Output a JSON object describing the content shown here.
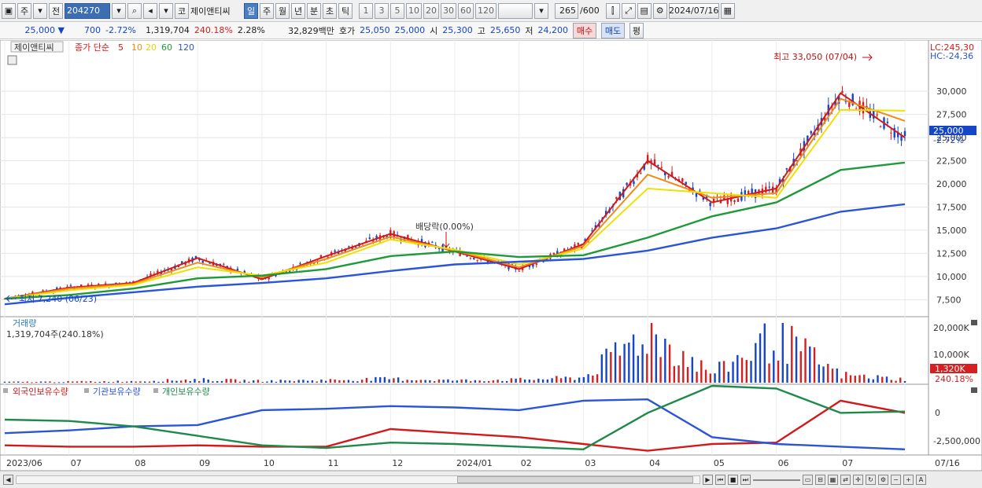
{
  "toolbar": {
    "market_label": "주",
    "prev_label": "전",
    "code_value": "204270",
    "co_label": "코",
    "stock_name": "제이앤티씨",
    "period_tabs": [
      "일",
      "주",
      "월",
      "년",
      "분",
      "초",
      "틱"
    ],
    "active_tab": "일",
    "interval_buttons": [
      "1",
      "3",
      "5",
      "10",
      "20",
      "30",
      "60",
      "120"
    ],
    "count_value": "265",
    "count_total": "/600",
    "date_value": "2024/07/16"
  },
  "quote": {
    "price": "25,000 ▼",
    "change": "700",
    "change_pct": "-2.72%",
    "volume": "1,319,704",
    "volume_ratio": "240.18%",
    "turnover_rate": "2.28%",
    "trade_value": "32,829백만",
    "bid_label": "호가",
    "bid1": "25,050",
    "bid2": "25,000",
    "open_label": "시",
    "open": "25,300",
    "high_label": "고",
    "high": "25,650",
    "low_label": "저",
    "low": "24,200",
    "buy_label": "매수",
    "sell_label": "매도",
    "eval_label": "평"
  },
  "legend": {
    "stock_name": "제이앤티씨",
    "ma_label": "종가 단순",
    "ma_periods": [
      "5",
      "10",
      "20",
      "60",
      "120"
    ],
    "ma_colors": [
      "#d21a1a",
      "#f08a1a",
      "#f0e000",
      "#1e9a3a",
      "#2a55d8"
    ]
  },
  "price_axis": {
    "ticks": [
      "30,000",
      "27,500",
      "25,000",
      "22,500",
      "20,000",
      "17,500",
      "15,000",
      "12,500",
      "10,000",
      "7,500"
    ],
    "lc": "LC:245,30",
    "hc": "HC:-24,36",
    "current": "25,000",
    "current_pct": "-2.72%"
  },
  "annotations": {
    "high": "최고 33,050 (07/04)",
    "dividend": "배당락(0.00%)",
    "low": "최저 7,240 (06/23)"
  },
  "volume_panel": {
    "title": "거래량",
    "value": "1,319,704주(240.18%)",
    "ticks": [
      "20,000K",
      "10,000K"
    ],
    "current": "1,320K",
    "current_pct": "240.18%"
  },
  "holdings_panel": {
    "series": [
      "외국인보유수량",
      "기관보유수량",
      "개인보유수량"
    ],
    "colors": [
      "#d21a1a",
      "#2a55d8",
      "#1e8a4a"
    ],
    "ticks": [
      "0",
      "-2,500,000"
    ]
  },
  "x_axis": {
    "labels": [
      "2023/06",
      "07",
      "08",
      "09",
      "10",
      "11",
      "12",
      "2024/01",
      "02",
      "03",
      "04",
      "05",
      "06",
      "07"
    ],
    "end_label": "07/16"
  },
  "chart_data": {
    "type": "line",
    "title": "",
    "ylim": [
      6000,
      34000
    ],
    "x": [
      "2023/06",
      "07",
      "08",
      "09",
      "10",
      "11",
      "12",
      "2024/01",
      "02",
      "03",
      "04",
      "05",
      "06",
      "07",
      "07/16"
    ],
    "series": [
      {
        "name": "5",
        "values": [
          7600,
          8800,
          9300,
          12000,
          9700,
          12200,
          14600,
          12700,
          10800,
          13500,
          22500,
          18000,
          19500,
          29800,
          25000
        ]
      },
      {
        "name": "10",
        "values": [
          7600,
          8700,
          9200,
          11500,
          9900,
          11900,
          14300,
          12800,
          11000,
          13300,
          21000,
          18500,
          19000,
          29200,
          26800
        ]
      },
      {
        "name": "20",
        "values": [
          7600,
          8500,
          9100,
          11000,
          10100,
          11500,
          14000,
          12900,
          11300,
          13000,
          19500,
          19000,
          18500,
          28000,
          27900
        ]
      },
      {
        "name": "60",
        "values": [
          7600,
          8000,
          8700,
          9800,
          10100,
          10800,
          12200,
          12700,
          12100,
          12300,
          14200,
          16500,
          18000,
          21500,
          22300
        ]
      },
      {
        "name": "120",
        "values": [
          7000,
          7700,
          8300,
          8900,
          9300,
          9800,
          10600,
          11300,
          11600,
          11900,
          12800,
          14200,
          15200,
          17000,
          17800
        ]
      }
    ],
    "volume_k": [
      300,
      400,
      600,
      1200,
      700,
      1000,
      1500,
      900,
      1200,
      2000,
      20000,
      3500,
      18000,
      3000,
      1320
    ],
    "holdings": {
      "foreign": [
        -2400000,
        -2500000,
        -2500000,
        -2400000,
        -2500000,
        -2500000,
        -1200000,
        -1500000,
        -1800000,
        -2300000,
        -2800000,
        -2300000,
        -2200000,
        900000,
        0
      ],
      "institution": [
        -1500000,
        -1300000,
        -1000000,
        -900000,
        200000,
        300000,
        500000,
        400000,
        200000,
        900000,
        1000000,
        -1800000,
        -2300000,
        -2500000,
        -2700000
      ],
      "individual": [
        -500000,
        -600000,
        -1000000,
        -1700000,
        -2400000,
        -2600000,
        -2200000,
        -2300000,
        -2500000,
        -2700000,
        0,
        2000000,
        1800000,
        0,
        100000
      ]
    }
  }
}
